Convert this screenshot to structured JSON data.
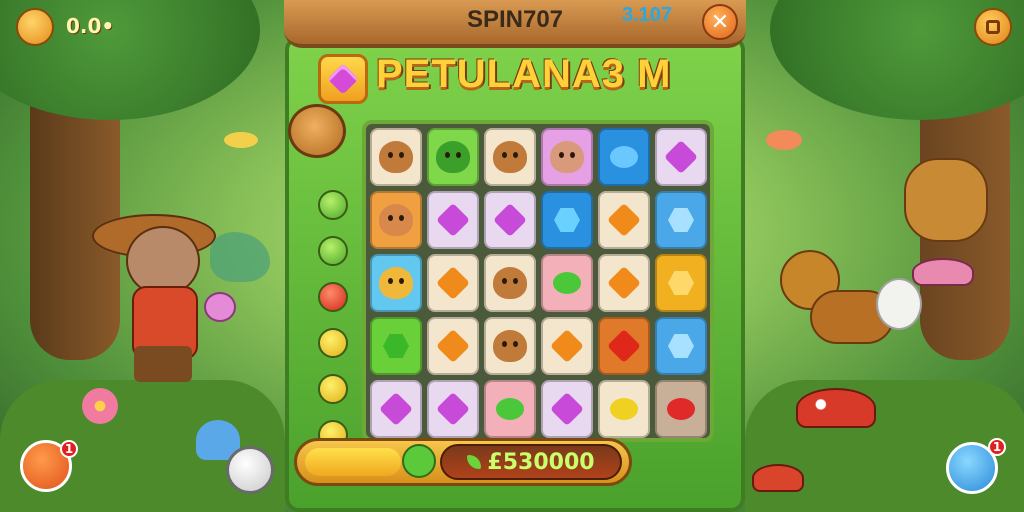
{
  "top_bar": {
    "coins_value": "0.0•",
    "game_name": "SPIN707",
    "score": "3.107",
    "close_symbol": "✕"
  },
  "banner": {
    "title": "PETULANA3 M"
  },
  "bottom_bar": {
    "counter_value": "£530000",
    "progress": 0.3
  },
  "badges": {
    "left_count": "1",
    "right_count": "1"
  },
  "board": {
    "rows": [
      [
        "face-brown",
        "face-green",
        "face-brown",
        "face-pink",
        "gem-blue-round",
        "gem-purple-diamond"
      ],
      [
        "face-orange",
        "gem-purple-diamond",
        "gem-purple-diamond",
        "gem-blue-tri",
        "gem-orange-diamond",
        "gem-blue-hex"
      ],
      [
        "face-yellow",
        "gem-orange-diamond",
        "face-brown",
        "gem-green-round",
        "gem-orange-diamond",
        "gem-gold-hex"
      ],
      [
        "gem-green-tri",
        "gem-orange-diamond",
        "face-brown",
        "gem-orange-diamond",
        "gem-red-diamond",
        "gem-blue-hex"
      ],
      [
        "gem-purple-diamond",
        "gem-purple-diamond",
        "gem-green-round",
        "gem-purple-diamond",
        "gem-yellow-round",
        "gem-red-round"
      ]
    ]
  },
  "side_orbs": [
    "green",
    "green",
    "red",
    "yellow",
    "yellow",
    "yellow"
  ]
}
